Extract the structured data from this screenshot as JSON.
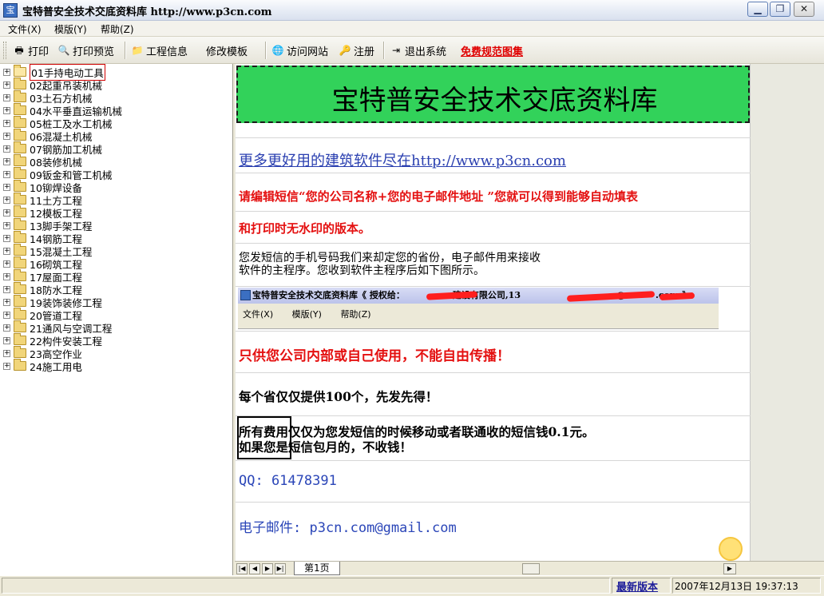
{
  "window": {
    "title": "宝特普安全技术交底资料库  http://www.p3cn.com",
    "minimize_glyph": "▁",
    "maximize_glyph": "❐",
    "close_glyph": "✕"
  },
  "menu": {
    "items": [
      "文件(X)",
      "模版(Y)",
      "帮助(Z)"
    ]
  },
  "toolbar": {
    "print": "打印",
    "print_preview": "打印预览",
    "project_info": "工程信息",
    "edit_template": "修改模板",
    "visit_site": "访问网站",
    "register": "注册",
    "exit": "退出系统",
    "free_atlas": "免费规范图集"
  },
  "tree": {
    "items": [
      {
        "label": "01手持电动工具",
        "selected": true
      },
      {
        "label": "02起重吊装机械"
      },
      {
        "label": "03土石方机械"
      },
      {
        "label": "04水平垂直运输机械"
      },
      {
        "label": "05桩工及水工机械"
      },
      {
        "label": "06混凝土机械"
      },
      {
        "label": "07钢筋加工机械"
      },
      {
        "label": "08装修机械"
      },
      {
        "label": "09钣金和管工机械"
      },
      {
        "label": "10铆焊设备"
      },
      {
        "label": "11土方工程"
      },
      {
        "label": "12模板工程"
      },
      {
        "label": "13脚手架工程"
      },
      {
        "label": "14钢筋工程"
      },
      {
        "label": "15混凝土工程"
      },
      {
        "label": "16砌筑工程"
      },
      {
        "label": "17屋面工程"
      },
      {
        "label": "18防水工程"
      },
      {
        "label": "19装饰装修工程"
      },
      {
        "label": "20管道工程"
      },
      {
        "label": "21通风与空调工程"
      },
      {
        "label": "22构件安装工程"
      },
      {
        "label": "23高空作业"
      },
      {
        "label": "24施工用电"
      }
    ]
  },
  "document": {
    "banner": "宝特普安全技术交底资料库",
    "link_line": "更多更好用的建筑软件尽在http://www.p3cn.com",
    "sms_line1": "请编辑短信“您的公司名称+您的电子邮件地址 ”您就可以得到能够自动填表",
    "sms_line2": "和打印时无水印的版本。",
    "plain_line1": "您发短信的手机号码我们来却定您的省份，电子邮件用来接收",
    "plain_line2": "软件的主程序。您收到软件主程序后如下图所示。",
    "embed_title": "宝特普安全技术交底资料库《 授权给：",
    "embed_title_mid": "建设有限公司,13",
    "embed_title_end": "@",
    "embed_title_tail": ".com 》",
    "embed_menu": [
      "文件(X)",
      "模版(Y)",
      "帮助(Z)"
    ],
    "internal_use": "只供您公司内部或自己使用，不能自由传播！",
    "limit_line": "每个省仅仅提供100个，先发先得！",
    "fee_line1": "所有费用仅仅为您发短信的时候移动或者联通收的短信钱0.1元。",
    "fee_line2": "如果您是短信包月的，不收钱！",
    "qq": "QQ: 61478391",
    "email": "电子邮件: p3cn.com@gmail.com"
  },
  "sheetbar": {
    "tab": "第1页",
    "nav": [
      "|◀",
      "◀",
      "▶",
      "▶|"
    ]
  },
  "status": {
    "latest_version": "最新版本",
    "datetime": "2007年12月13日  19:37:13"
  },
  "colors": {
    "banner_bg": "#32d25a",
    "red_text": "#e41010",
    "link_blue": "#2a3fb0",
    "info_blue": "#2b46b8"
  }
}
